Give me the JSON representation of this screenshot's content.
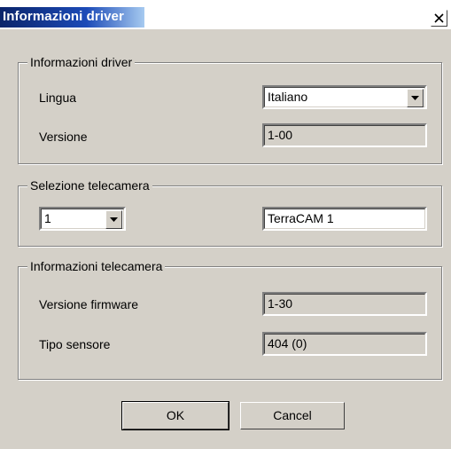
{
  "window": {
    "title": "Informazioni driver"
  },
  "group_driver": {
    "label": "Informazioni driver",
    "language_label": "Lingua",
    "language_value": "Italiano",
    "version_label": "Versione",
    "version_value": "1-00"
  },
  "group_camera_select": {
    "label": "Selezione telecamera",
    "camera_number": "1",
    "camera_name": "TerraCAM 1"
  },
  "group_camera_info": {
    "label": "Informazioni telecamera",
    "firmware_label": "Versione firmware",
    "firmware_value": "1-30",
    "sensor_label": "Tipo sensore",
    "sensor_value": "404 (0)"
  },
  "buttons": {
    "ok": "OK",
    "cancel": "Cancel"
  }
}
